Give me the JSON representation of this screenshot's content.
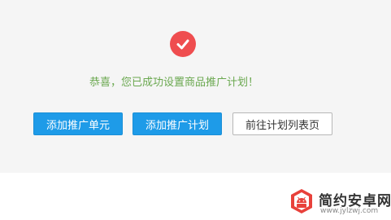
{
  "status": {
    "icon": "check-icon",
    "icon_color": "#ef4d4f",
    "message": "恭喜，您已成功设置商品推广计划！",
    "message_color": "#6aa84f"
  },
  "actions": {
    "add_unit_label": "添加推广单元",
    "add_plan_label": "添加推广计划",
    "go_to_list_label": "前往计划列表页",
    "primary_color": "#1e9be8"
  },
  "watermark": {
    "title": "简约安卓网",
    "url": "www.jylzwj.com",
    "icon": "android-logo-icon"
  }
}
